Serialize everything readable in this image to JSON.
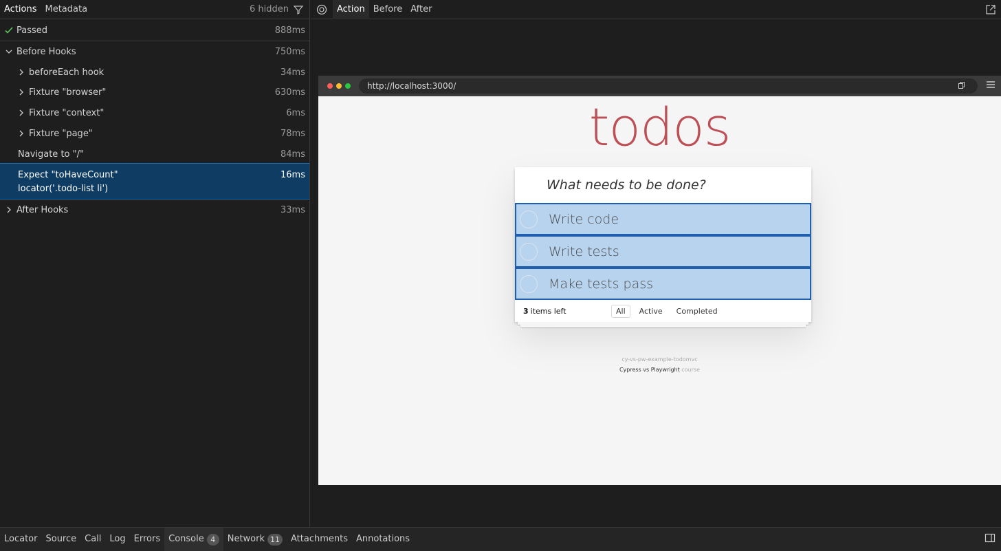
{
  "left_tabs": {
    "actions": "Actions",
    "metadata": "Metadata",
    "hidden": "6 hidden"
  },
  "tree": [
    {
      "label": "Passed",
      "duration": "888ms",
      "icon": "check-icon"
    },
    {
      "label": "Before Hooks",
      "duration": "750ms",
      "icon": "chevron-down-icon"
    },
    {
      "label": "beforeEach hook",
      "duration": "34ms",
      "icon": "chevron-right-icon"
    },
    {
      "label": "Fixture \"browser\"",
      "duration": "630ms",
      "icon": "chevron-right-icon"
    },
    {
      "label": "Fixture \"context\"",
      "duration": "6ms",
      "icon": "chevron-right-icon"
    },
    {
      "label": "Fixture \"page\"",
      "duration": "78ms",
      "icon": "chevron-right-icon"
    },
    {
      "label": "Navigate to \"/\"",
      "duration": "84ms"
    },
    {
      "label": "Expect \"toHaveCount\"",
      "sublabel": "locator('.todo-list li')",
      "duration": "16ms"
    },
    {
      "label": "After Hooks",
      "duration": "33ms",
      "icon": "chevron-right-icon"
    }
  ],
  "right_tabs": {
    "action": "Action",
    "before": "Before",
    "after": "After"
  },
  "browser": {
    "url": "http://localhost:3000/",
    "title": "todos",
    "placeholder": "What needs to be done?",
    "items": [
      "Write code",
      "Write tests",
      "Make tests pass"
    ],
    "count": "3",
    "count_suffix": "items left",
    "filters": [
      "All",
      "Active",
      "Completed"
    ],
    "info_repo": "cy-vs-pw-example-todomvc",
    "info_course_main": "Cypress vs Playwright",
    "info_course_suffix": "course"
  },
  "bottom_tabs": {
    "locator": "Locator",
    "source": "Source",
    "call": "Call",
    "log": "Log",
    "errors": "Errors",
    "console": "Console",
    "console_count": "4",
    "network": "Network",
    "network_count": "11",
    "attachments": "Attachments",
    "annotations": "Annotations"
  },
  "colors": {
    "selected_row": "#0e3c63",
    "highlight": "#b8d3ee",
    "title_red": "#b83f45",
    "pass_green": "#5ac85a"
  }
}
